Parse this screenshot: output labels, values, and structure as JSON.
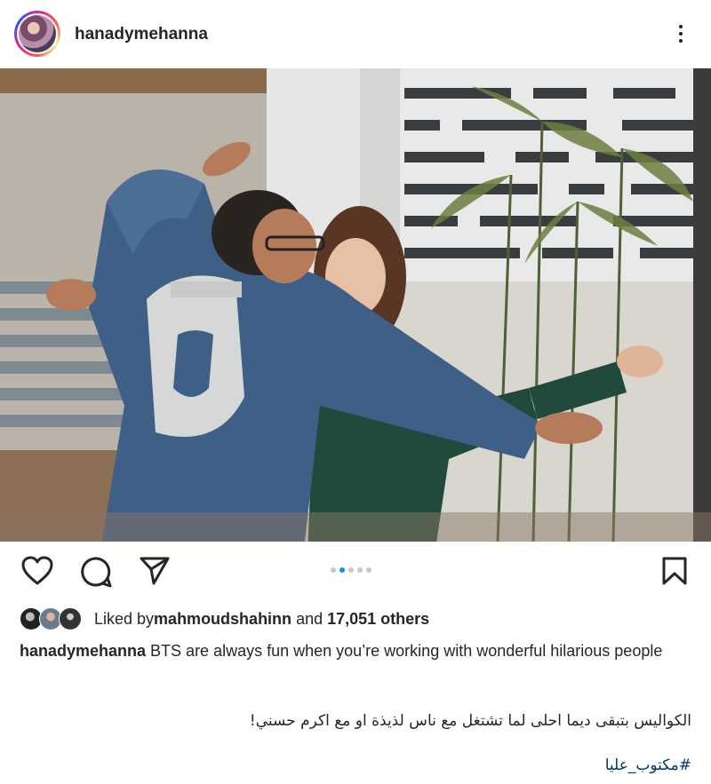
{
  "post": {
    "username": "hanadymehanna",
    "icons": {
      "avatar": "profile-avatar",
      "more": "more-options-icon"
    }
  },
  "carousel": {
    "total": 5,
    "active_index": 1
  },
  "actions": {
    "like_icon": "heart-icon",
    "comment_icon": "comment-icon",
    "share_icon": "send-icon",
    "save_icon": "bookmark-icon"
  },
  "likes": {
    "prefix": "Liked by ",
    "user": "mahmoudshahinn",
    "middle": " and ",
    "count": "17,051 others"
  },
  "caption": {
    "username": "hanadymehanna",
    "text": " BTS are always fun when you’re working with wonderful hilarious people",
    "arabic": "الكواليس بتبقى ديما احلى لما تشتغل مع ناس لذيذة او مع اكرم حسني!",
    "hashtag": "#مكتوب_عليا"
  },
  "colors": {
    "text": "#262626",
    "link": "#00376b",
    "dot_active": "#0095f6",
    "dot_inactive": "#c7c7c7"
  }
}
